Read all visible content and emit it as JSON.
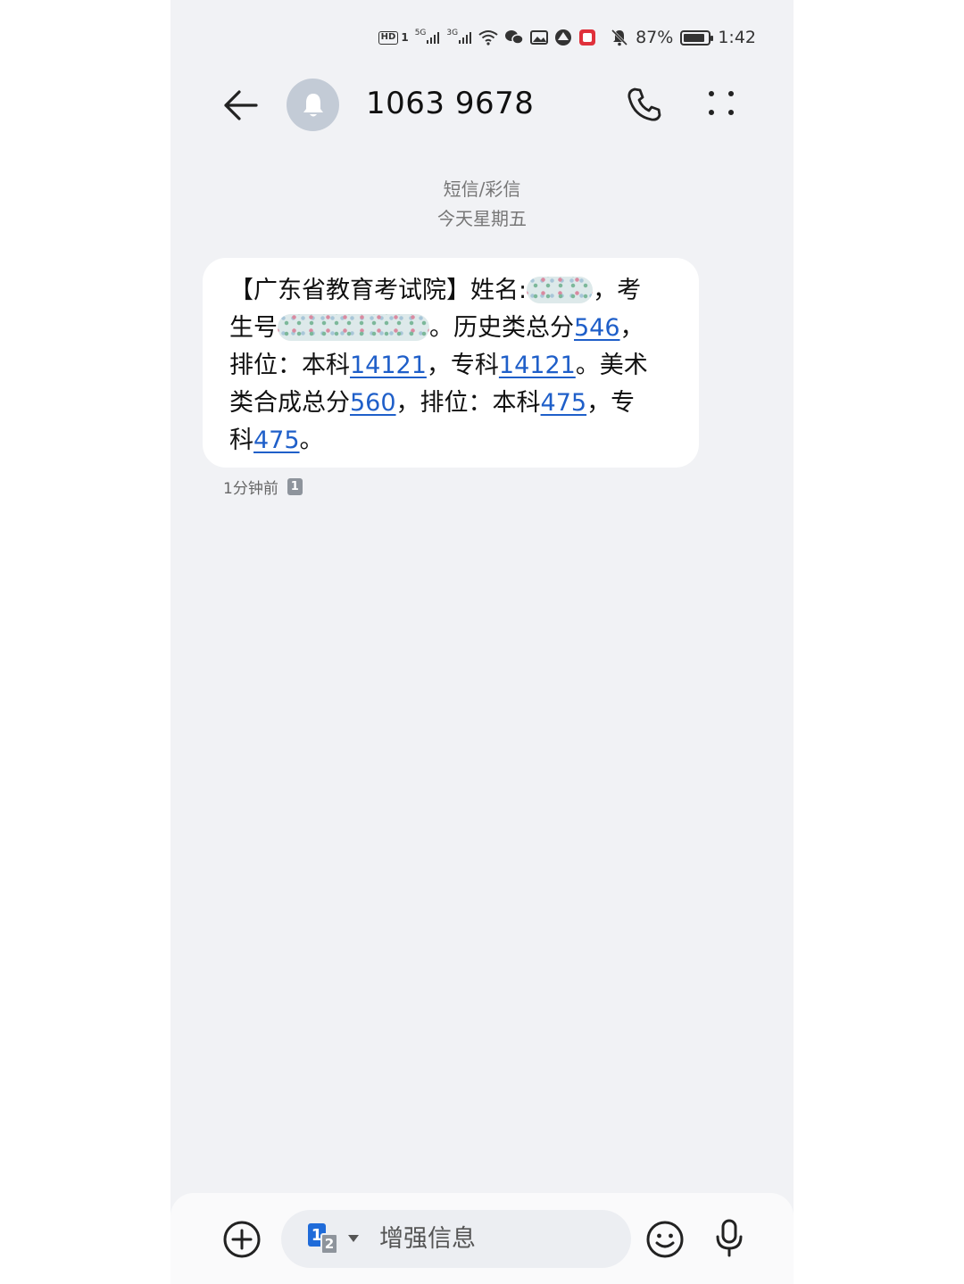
{
  "status_bar": {
    "hd": "HD",
    "sim1": "1",
    "network1": "5G",
    "network2": "3G",
    "battery_percent": "87%",
    "battery_level": 0.87,
    "time": "1:42"
  },
  "header": {
    "contact": "1063 9678"
  },
  "conversation": {
    "type": "短信/彩信",
    "date": "今天星期五"
  },
  "message": {
    "line1_prefix": "【广东省教育考试院】姓名:",
    "line1_suffix": "，考",
    "line2_prefix": "生号",
    "line2_mid": "。历史类总分",
    "history_total": "546",
    "line2_suffix": "，",
    "line3_prefix": "排位：本科",
    "history_rank_bachelor": "14121",
    "line3_mid": "，专科",
    "history_rank_college": "14121",
    "line3_suffix": "。美术",
    "line4_prefix": "类合成总分",
    "art_total": "560",
    "line4_mid": "，排位：本科",
    "art_rank_bachelor": "475",
    "line4_suffix": "，专",
    "line5_prefix": "科",
    "art_rank_college": "475",
    "line5_suffix": "。",
    "time": "1分钟前",
    "sim": "1"
  },
  "composer": {
    "sim_primary": "1",
    "sim_secondary": "2",
    "placeholder": "增强信息"
  },
  "colors": {
    "background": "#f1f2f5",
    "bubble": "#ffffff",
    "link": "#1f5fc9",
    "sim_blue": "#1f6bd9"
  }
}
